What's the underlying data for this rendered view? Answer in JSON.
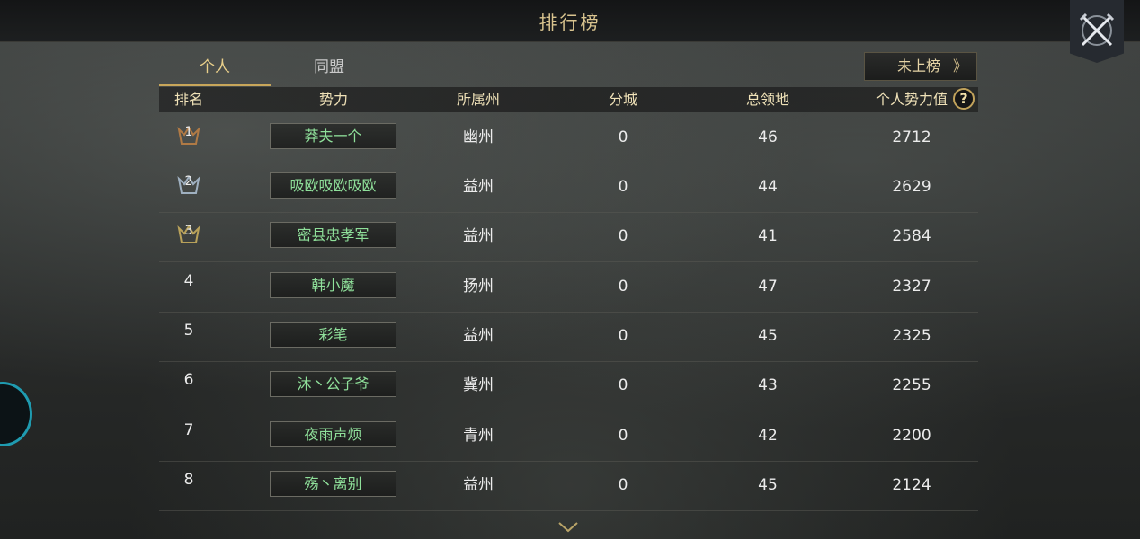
{
  "header": {
    "title": "排行榜"
  },
  "tabs": [
    {
      "label": "个人"
    },
    {
      "label": "同盟"
    }
  ],
  "unranked_button": {
    "label": "未上榜",
    "chevron": "》"
  },
  "columns": [
    "排名",
    "势力",
    "所属州",
    "分城",
    "总领地",
    "个人势力值"
  ],
  "help_icon": "?",
  "rows": [
    {
      "rank": "1",
      "name": "莽夫一个",
      "state": "幽州",
      "branch_city": "0",
      "territory": "46",
      "power": "2712",
      "medal": "bronze-medal-icon"
    },
    {
      "rank": "2",
      "name": "吸欧吸欧吸欧",
      "state": "益州",
      "branch_city": "0",
      "territory": "44",
      "power": "2629",
      "medal": "silver-medal-icon"
    },
    {
      "rank": "3",
      "name": "密县忠孝军",
      "state": "益州",
      "branch_city": "0",
      "territory": "41",
      "power": "2584",
      "medal": "gold-medal-icon"
    },
    {
      "rank": "4",
      "name": "韩小魔",
      "state": "扬州",
      "branch_city": "0",
      "territory": "47",
      "power": "2327"
    },
    {
      "rank": "5",
      "name": "彩笔",
      "state": "益州",
      "branch_city": "0",
      "territory": "45",
      "power": "2325"
    },
    {
      "rank": "6",
      "name": "沐丶公子爷",
      "state": "冀州",
      "branch_city": "0",
      "territory": "43",
      "power": "2255"
    },
    {
      "rank": "7",
      "name": "夜雨声烦",
      "state": "青州",
      "branch_city": "0",
      "territory": "42",
      "power": "2200"
    },
    {
      "rank": "8",
      "name": "殇丶离别",
      "state": "益州",
      "branch_city": "0",
      "territory": "45",
      "power": "2124"
    }
  ],
  "colors": {
    "accent": "#d9c48f",
    "name_text": "#8fe09a",
    "bronze": "#b07a45",
    "silver": "#9fb0c0",
    "gold": "#b8a15a"
  }
}
